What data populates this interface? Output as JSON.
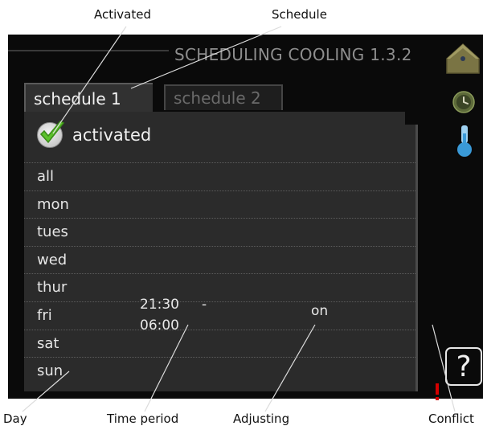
{
  "callouts": {
    "activated": "Activated",
    "schedule": "Schedule",
    "day": "Day",
    "time_period": "Time period",
    "adjusting": "Adjusting",
    "conflict": "Conflict"
  },
  "screen": {
    "title": "SCHEDULING COOLING 1.3.2",
    "tabs": [
      {
        "label": "schedule 1",
        "active": true
      },
      {
        "label": "schedule 2",
        "active": false
      }
    ],
    "activated_label": "activated",
    "days": [
      "all",
      "mon",
      "tues",
      "wed",
      "thur",
      "fri",
      "sat",
      "sun"
    ],
    "time_period": {
      "start": "21:30",
      "dash": "-",
      "end": "06:00"
    },
    "adjusting_value": "on",
    "conflict_marker": "!",
    "help_label": "?"
  },
  "side_icons": [
    "house-icon",
    "clock-icon",
    "thermometer-icon"
  ],
  "colors": {
    "screen_bg": "#0a0a0a",
    "panel_bg": "#2b2b2b",
    "house": "#7a7444",
    "clock": "#5d6a3a",
    "thermometer": "#3a9ad8",
    "check_green": "#5cc22b",
    "conflict_red": "#d40000"
  }
}
